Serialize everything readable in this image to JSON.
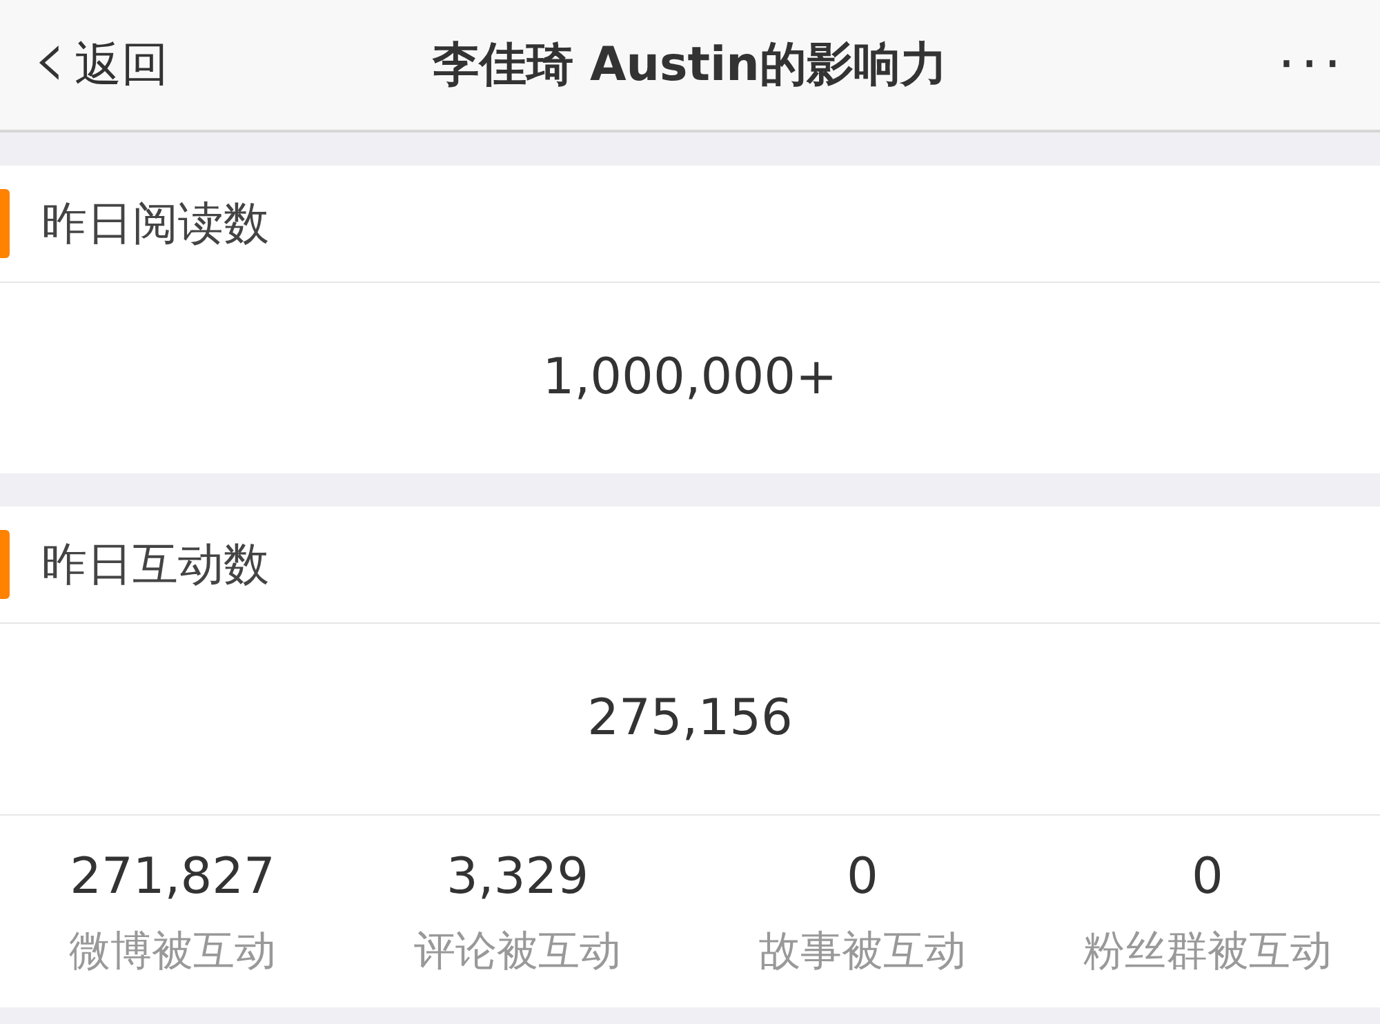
{
  "nav_bar": {
    "back": {
      "arrow": "‹",
      "label": "返回"
    },
    "title": "李佳琦 Austin的影响力",
    "more": "···"
  },
  "sections": [
    {
      "title": "昨日阅读数",
      "value": "1,000,000+"
    },
    {
      "title": "昨日互动数",
      "value": "275,156",
      "stats": [
        {
          "value": "271,827",
          "label": "微博被互动"
        },
        {
          "value": "3,329",
          "label": "评论被互动"
        },
        {
          "value": "0",
          "label": "故事被互动"
        },
        {
          "value": "0",
          "label": "粉丝群被互动"
        }
      ]
    }
  ]
}
